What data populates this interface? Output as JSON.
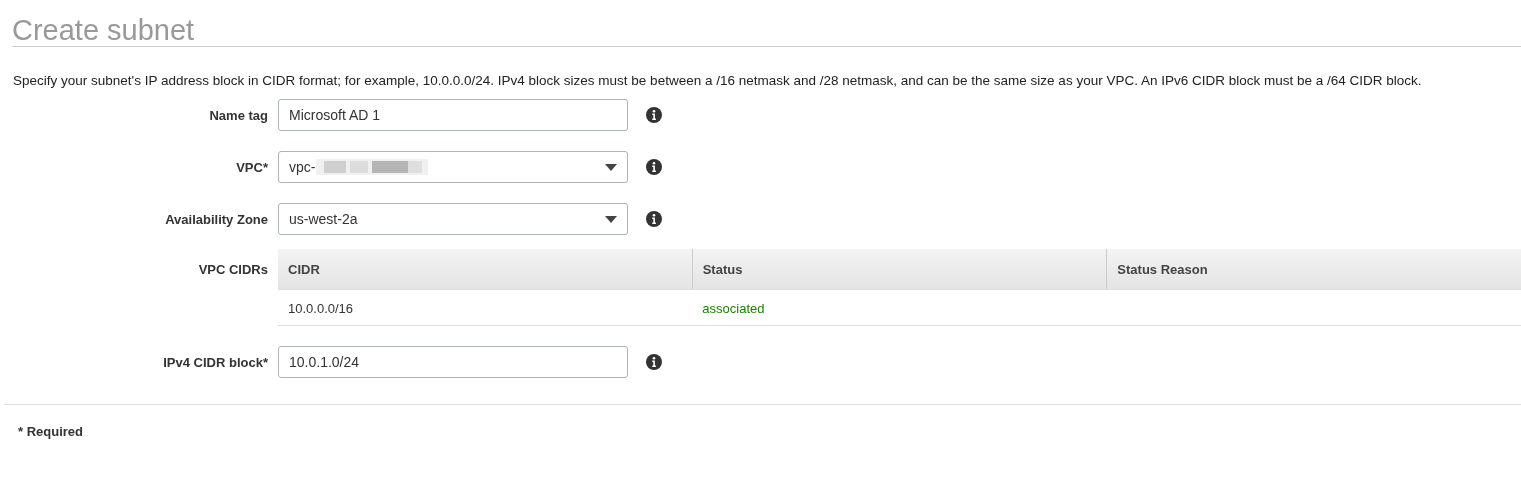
{
  "title": "Create subnet",
  "description": "Specify your subnet's IP address block in CIDR format; for example, 10.0.0.0/24. IPv4 block sizes must be between a /16 netmask and /28 netmask, and can be the same size as your VPC. An IPv6 CIDR block must be a /64 CIDR block.",
  "fields": [
    {
      "kind": "input",
      "label": "Name tag",
      "value": "Microsoft AD 1"
    },
    {
      "kind": "select",
      "label": "VPC*",
      "value": "vpc-",
      "redacted": true
    },
    {
      "kind": "select",
      "label": "Availability Zone",
      "value": "us-west-2a",
      "redacted": false
    },
    {
      "kind": "table",
      "label": "VPC CIDRs",
      "columns": [
        "CIDR",
        "Status",
        "Status Reason"
      ],
      "rows": [
        [
          "10.0.0.0/16",
          "associated",
          ""
        ]
      ]
    },
    {
      "kind": "input",
      "label": "IPv4 CIDR block*",
      "value": "10.0.1.0/24"
    }
  ],
  "footnote": "* Required"
}
